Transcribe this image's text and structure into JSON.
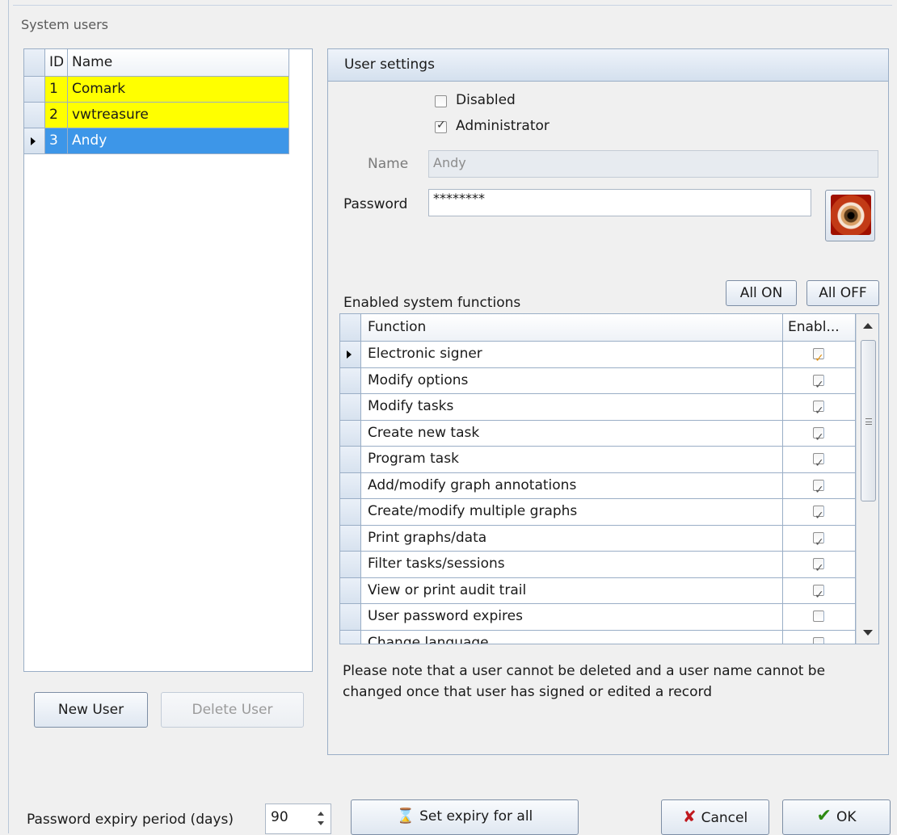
{
  "window": {
    "group_title": "System users"
  },
  "users": {
    "columns": [
      "ID",
      "Name"
    ],
    "rows": [
      {
        "id": "1",
        "name": "Comark",
        "highlight": "yellow"
      },
      {
        "id": "2",
        "name": "vwtreasure",
        "highlight": "yellow"
      },
      {
        "id": "3",
        "name": "Andy",
        "highlight": "selected"
      }
    ],
    "new_user_label": "New User",
    "delete_user_label": "Delete User"
  },
  "settings": {
    "title": "User settings",
    "disabled_label": "Disabled",
    "disabled_checked": false,
    "administrator_label": "Administrator",
    "administrator_checked": true,
    "name_label": "Name",
    "name_value": "Andy",
    "password_label": "Password",
    "password_value": "********",
    "functions_label": "Enabled system functions",
    "all_on_label": "All ON",
    "all_off_label": "All OFF",
    "functions_columns": [
      "Function",
      "Enabl..."
    ],
    "functions": [
      {
        "name": "Electronic signer",
        "enabled": true
      },
      {
        "name": "Modify options",
        "enabled": true
      },
      {
        "name": "Modify tasks",
        "enabled": true
      },
      {
        "name": "Create new task",
        "enabled": true
      },
      {
        "name": "Program task",
        "enabled": true
      },
      {
        "name": "Add/modify graph annotations",
        "enabled": true
      },
      {
        "name": "Create/modify multiple graphs",
        "enabled": true
      },
      {
        "name": "Print graphs/data",
        "enabled": true
      },
      {
        "name": "Filter tasks/sessions",
        "enabled": true
      },
      {
        "name": "View or print audit trail",
        "enabled": true
      },
      {
        "name": "User password expires",
        "enabled": false
      },
      {
        "name": "Change language",
        "enabled": true
      }
    ],
    "note": "Please note that a user cannot be deleted and a user name cannot be changed once that user has signed or edited a record"
  },
  "footer": {
    "expiry_label": "Password expiry period (days)",
    "expiry_value": "90",
    "set_expiry_label": "Set expiry for all",
    "cancel_label": "Cancel",
    "ok_label": "OK"
  }
}
